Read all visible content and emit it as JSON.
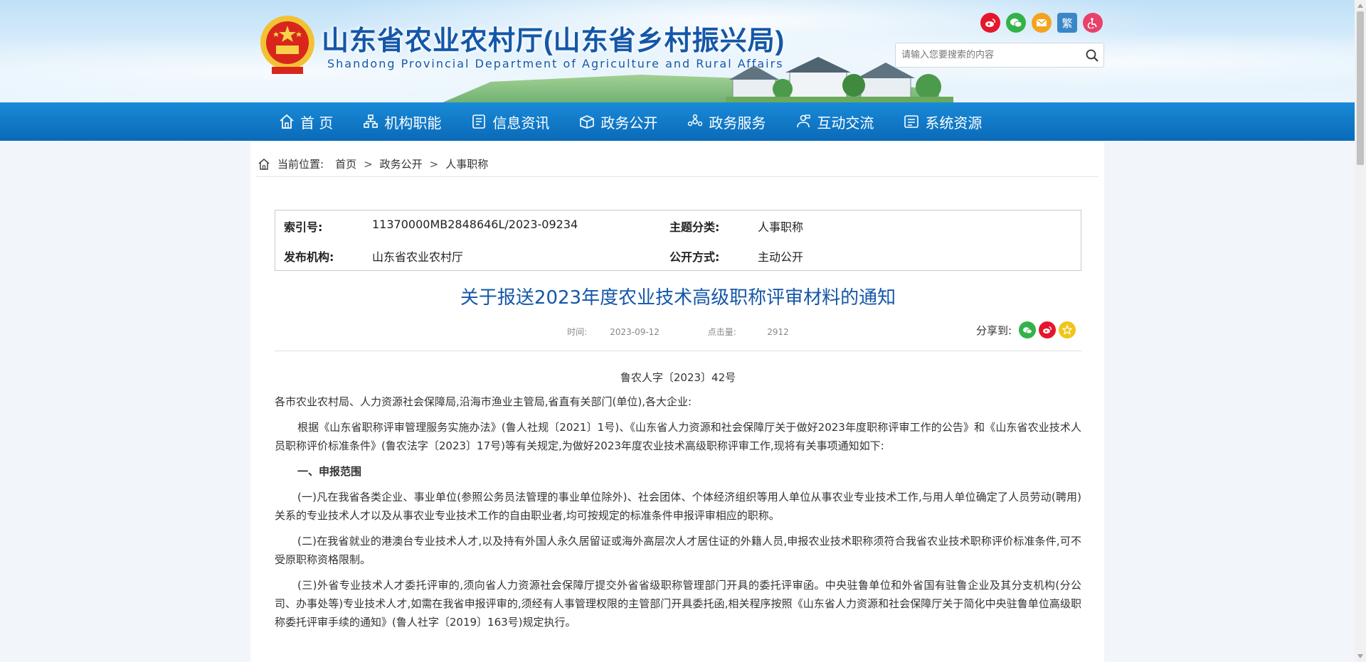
{
  "header": {
    "title": "山东省农业农村厅(山东省乡村振兴局)",
    "subtitle": "Shandong Provincial Department of Agriculture and Rural Affairs",
    "tools": {
      "weibo": "weibo-icon",
      "wechat": "wechat-icon",
      "mail": "mail-icon",
      "traditional": "繁",
      "accessibility": "accessibility-icon"
    },
    "search": {
      "placeholder": "请输入您要搜索的内容"
    }
  },
  "nav": {
    "items": [
      {
        "label": "首 页",
        "icon": "home-icon"
      },
      {
        "label": "机构职能",
        "icon": "org-chart-icon"
      },
      {
        "label": "信息资讯",
        "icon": "document-list-icon"
      },
      {
        "label": "政务公开",
        "icon": "box-icon"
      },
      {
        "label": "政务服务",
        "icon": "service-icon"
      },
      {
        "label": "互动交流",
        "icon": "interaction-icon"
      },
      {
        "label": "系统资源",
        "icon": "system-icon"
      }
    ]
  },
  "breadcrumb": {
    "prefix": "当前位置:",
    "items": [
      "首页",
      "政务公开",
      "人事职称"
    ],
    "separator": ">"
  },
  "meta": {
    "index_label": "索引号:",
    "index_value": "11370000MB2848646L/2023-09234",
    "topic_label": "主题分类:",
    "topic_value": "人事职称",
    "publisher_label": "发布机构:",
    "publisher_value": "山东省农业农村厅",
    "disclosure_label": "公开方式:",
    "disclosure_value": "主动公开"
  },
  "article": {
    "title": "关于报送2023年度农业技术高级职称评审材料的通知",
    "time_label": "时间:",
    "time_value": "2023-09-12",
    "clicks_label": "点击量:",
    "clicks_value": "2912",
    "share_label": "分享到:",
    "doc_number": "鲁农人字〔2023〕42号",
    "recipients": "各市农业农村局、人力资源社会保障局,沿海市渔业主管局,省直有关部门(单位),各大企业:",
    "para1": "根据《山东省职称评审管理服务实施办法》(鲁人社规〔2021〕1号)、《山东省人力资源和社会保障厅关于做好2023年度职称评审工作的公告》和《山东省农业技术人员职称评价标准条件》(鲁农法字〔2023〕17号)等有关规定,为做好2023年度农业技术高级职称评审工作,现将有关事项通知如下:",
    "section1": "一、申报范围",
    "item1": "(一)凡在我省各类企业、事业单位(参照公务员法管理的事业单位除外)、社会团体、个体经济组织等用人单位从事农业专业技术工作,与用人单位确定了人员劳动(聘用)关系的专业技术人才以及从事农业专业技术工作的自由职业者,均可按规定的标准条件申报评审相应的职称。",
    "item2": "(二)在我省就业的港澳台专业技术人才,以及持有外国人永久居留证或海外高层次人才居住证的外籍人员,申报农业技术职称须符合我省农业技术职称评价标准条件,可不受原职称资格限制。",
    "item3": "(三)外省专业技术人才委托评审的,须向省人力资源社会保障厅提交外省省级职称管理部门开具的委托评审函。中央驻鲁单位和外省国有驻鲁企业及其分支机构(分公司、办事处等)专业技术人才,如需在我省申报评审的,须经有人事管理权限的主管部门开具委托函,相关程序按照《山东省人力资源和社会保障厅关于简化中央驻鲁单位高级职称委托评审手续的通知》(鲁人社字〔2019〕163号)规定执行。"
  },
  "colors": {
    "nav_blue": "#0a6ab8",
    "title_blue": "#1457a8",
    "weibo_red": "#e6162d",
    "wechat_green": "#34b24a",
    "favorite_yellow": "#f0c419"
  }
}
